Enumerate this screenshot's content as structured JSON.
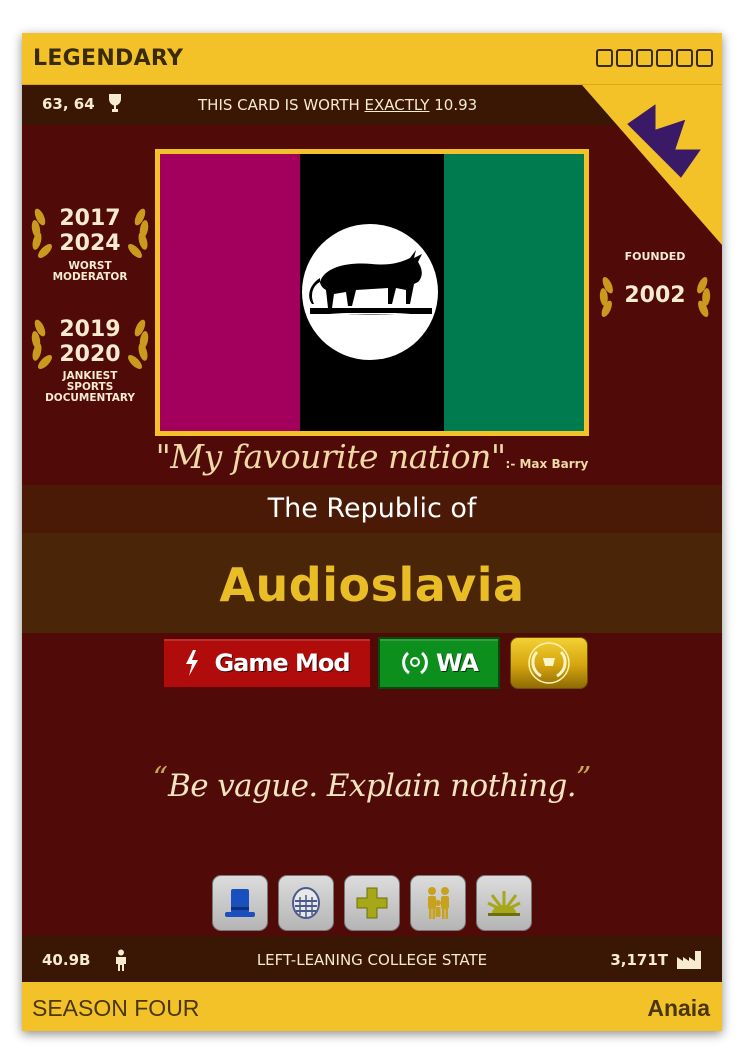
{
  "card": {
    "rarity": "LEGENDARY",
    "rarity_box_count": 6,
    "rank": "63, 64",
    "worth_prefix": "THIS CARD IS WORTH",
    "worth_emphasis": "EXACTLY",
    "worth_value": "10.93",
    "flag_stripes": [
      "#a3005e",
      "#000000",
      "#007a4f"
    ],
    "badges": [
      {
        "years": [
          "2017",
          "2024"
        ],
        "label": [
          "WORST",
          "MODERATOR"
        ]
      },
      {
        "years": [
          "2019",
          "2020"
        ],
        "label": [
          "JANKIEST",
          "SPORTS",
          "DOCUMENTARY"
        ]
      }
    ],
    "founded": {
      "label": "FOUNDED",
      "year": "2002"
    },
    "quote": "\"My favourite nation\"",
    "quote_author": ":- Max Barry",
    "pretitle": "The Republic of",
    "name": "Audioslavia",
    "tags": {
      "gamemod": "Game Mod",
      "wa": "WA"
    },
    "motto_open": "“",
    "motto": "Be vague. Explain nothing.",
    "motto_close": "”",
    "policy_icons": [
      "top-hat-icon",
      "stadium-icon",
      "medical-cross-icon",
      "family-icon",
      "sunrise-icon"
    ],
    "population": "40.9B",
    "category": "LEFT-LEANING COLLEGE STATE",
    "gdp": "3,171T",
    "season": "SEASON FOUR",
    "region": "Anaia"
  },
  "colors": {
    "gold": "#f2c228",
    "maroon": "#500a08",
    "name_gold": "#e8bd26",
    "gamemod_red": "#b00c0c",
    "wa_green": "#0d8f1d",
    "crown_purple": "#3a1a66"
  }
}
